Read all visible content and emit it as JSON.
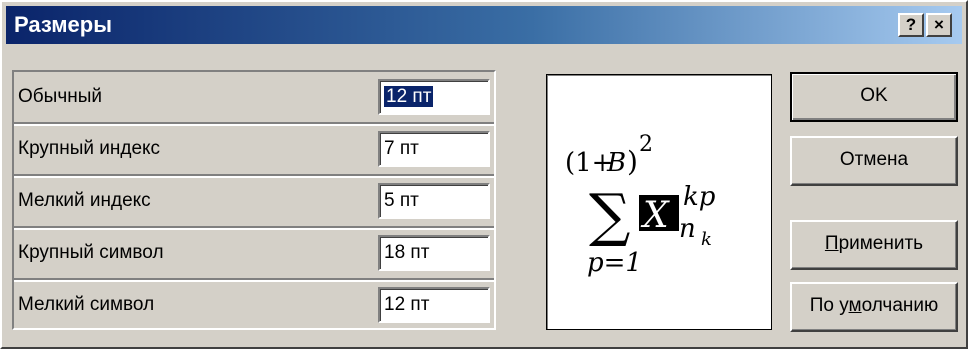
{
  "window": {
    "title": "Размеры",
    "help_label": "?",
    "close_label": "×"
  },
  "sizes": {
    "rows": [
      {
        "label": "Обычный",
        "value": "12 пт"
      },
      {
        "label": "Крупный индекс",
        "value": "7 пт"
      },
      {
        "label": "Мелкий индекс",
        "value": "5 пт"
      },
      {
        "label": "Крупный символ",
        "value": "18 пт"
      },
      {
        "label": "Мелкий символ",
        "value": "12 пт"
      }
    ]
  },
  "preview": {
    "open_paren": "(1+",
    "var_b": "B",
    "close_paren": ")",
    "power": "2",
    "sum": "∑",
    "var_x": "X",
    "sup": "kp",
    "sub_n": "n",
    "sub_k": "k",
    "lower_limit": "p=1"
  },
  "buttons": {
    "ok": "OK",
    "cancel": "Отмена",
    "apply": "Применить",
    "apply_mnemonic": "П",
    "apply_rest": "рименить",
    "default_pre": "По у",
    "default_mnemonic": "м",
    "default_rest": "олчанию"
  },
  "colors": {
    "title_start": "#0a246a",
    "title_end": "#a6caf0",
    "selection": "#0a246a",
    "face": "#d4d0c8"
  }
}
